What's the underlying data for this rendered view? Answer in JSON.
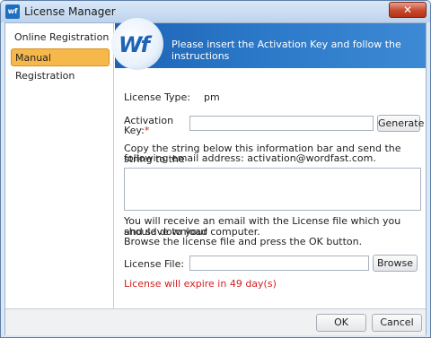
{
  "window": {
    "title": "License Manager",
    "app_icon": "wf-icon",
    "close_glyph": "✕"
  },
  "sidebar": {
    "items": [
      {
        "label": "Online Registration",
        "active": false
      },
      {
        "label": "Manual Registration",
        "active": true
      }
    ]
  },
  "banner": {
    "logo_text": "Wf",
    "text": "Please insert the Activation Key and follow the instructions"
  },
  "form": {
    "license_type_label": "License Type:",
    "license_type_value": "pm",
    "activation_key_label_line1": "Activation",
    "activation_key_label_line2": "Key:",
    "required_mark": "*",
    "activation_key_value": "",
    "generate_label": "Generate",
    "copy_instructions_line1": "Copy the string below this information bar and send the string to the",
    "copy_instructions_line2": "following email address: activation@wordfast.com.",
    "request_string_value": "",
    "receive_info_line1": "You will receive an email with the License file which you should download",
    "receive_info_line2": "and save to your computer.",
    "receive_info_line3": "Browse the license file and press the OK button.",
    "license_file_label": "License File:",
    "license_file_value": "",
    "browse_label": "Browse",
    "expiry_text": "License will expire in 49 day(s)"
  },
  "footer": {
    "ok_label": "OK",
    "cancel_label": "Cancel"
  },
  "colors": {
    "active_nav": "#f6b84a",
    "banner_blue": "#1e63b5",
    "warning_red": "#d21f1f",
    "close_red": "#c8482e"
  }
}
